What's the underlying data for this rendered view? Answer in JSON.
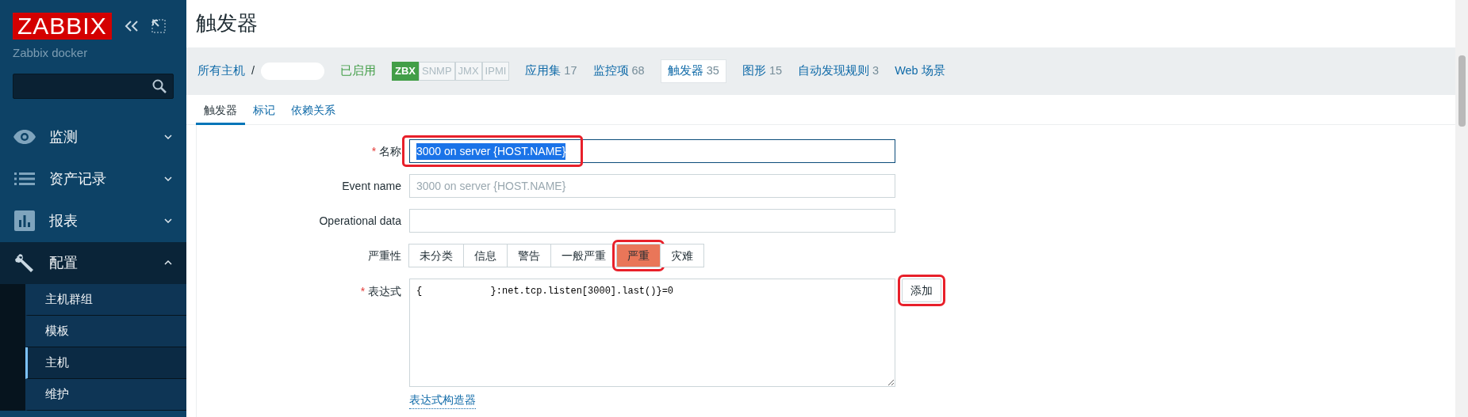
{
  "sidebar": {
    "logo": "ZABBIX",
    "server_name": "Zabbix docker",
    "menu": [
      {
        "label": "监测",
        "expanded": false
      },
      {
        "label": "资产记录",
        "expanded": false
      },
      {
        "label": "报表",
        "expanded": false
      },
      {
        "label": "配置",
        "expanded": true,
        "children": [
          {
            "label": "主机群组",
            "selected": false
          },
          {
            "label": "模板",
            "selected": false
          },
          {
            "label": "主机",
            "selected": true
          },
          {
            "label": "维护",
            "selected": false
          }
        ]
      }
    ]
  },
  "page_title": "触发器",
  "breadcrumb": {
    "root": "所有主机",
    "separator": "/",
    "host_redacted": true,
    "status": "已启用",
    "availability": [
      {
        "label": "ZBX",
        "on": true
      },
      {
        "label": "SNMP",
        "on": false
      },
      {
        "label": "JMX",
        "on": false
      },
      {
        "label": "IPMI",
        "on": false
      }
    ],
    "links": [
      {
        "label": "应用集",
        "count": "17",
        "selected": false
      },
      {
        "label": "监控项",
        "count": "68",
        "selected": false
      },
      {
        "label": "触发器",
        "count": "35",
        "selected": true
      },
      {
        "label": "图形",
        "count": "15",
        "selected": false
      },
      {
        "label": "自动发现规则",
        "count": "3",
        "selected": false
      },
      {
        "label": "Web 场景",
        "selected": false
      }
    ]
  },
  "tabs": [
    {
      "label": "触发器",
      "selected": true
    },
    {
      "label": "标记",
      "selected": false
    },
    {
      "label": "依赖关系",
      "selected": false
    }
  ],
  "form": {
    "name": {
      "label": "名称",
      "required_mark": "*",
      "value": "3000 on server {HOST.NAME}",
      "text_selected": true,
      "annotated": true
    },
    "event_name": {
      "label": "Event name",
      "placeholder": "3000 on server {HOST.NAME}"
    },
    "operational_data": {
      "label": "Operational data"
    },
    "severity": {
      "label": "严重性",
      "annotated": true,
      "options": [
        {
          "label": "未分类",
          "selected": false
        },
        {
          "label": "信息",
          "selected": false
        },
        {
          "label": "警告",
          "selected": false
        },
        {
          "label": "一般严重",
          "selected": false
        },
        {
          "label": "严重",
          "selected": true
        },
        {
          "label": "灾难",
          "selected": false
        }
      ]
    },
    "expression": {
      "label": "表达式",
      "required_mark": "*",
      "value": "{            }:net.tcp.listen[3000].last()}=0",
      "add_button": "添加",
      "add_annotated": true,
      "constructor_link": "表达式构造器"
    }
  }
}
